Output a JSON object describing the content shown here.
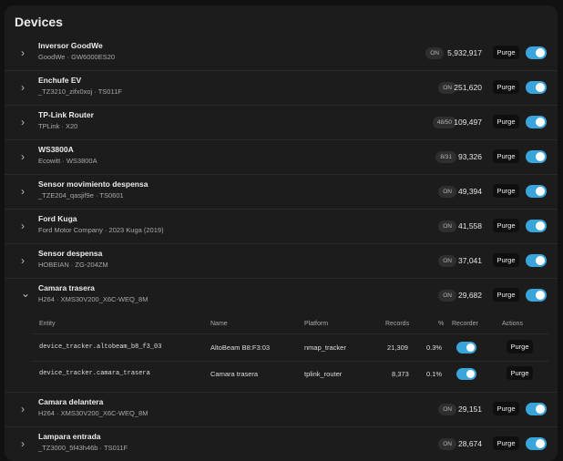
{
  "card": {
    "title": "Devices",
    "accent": "#3aa5db"
  },
  "devices": [
    {
      "name": "Inversor GoodWe",
      "sub": "GoodWe · GW6000ES20",
      "chip": "ON",
      "count": "5,932,917",
      "purge": "Purge",
      "enabled": true
    },
    {
      "name": "Enchufe EV",
      "sub": "_TZ3210_zifx0xoj · TS011F",
      "chip": "ON",
      "count": "251,620",
      "purge": "Purge",
      "enabled": true
    },
    {
      "name": "TP-Link Router",
      "sub": "TPLink · X20",
      "chip": "48/50",
      "count": "109,497",
      "purge": "Purge",
      "enabled": true
    },
    {
      "name": "WS3800A",
      "sub": "Ecowitt · WS3800A",
      "chip": "8/31",
      "count": "93,326",
      "purge": "Purge",
      "enabled": true
    },
    {
      "name": "Sensor movimiento despensa",
      "sub": "_TZE204_qasjif9e · TS0601",
      "chip": "ON",
      "count": "49,394",
      "purge": "Purge",
      "enabled": true
    },
    {
      "name": "Ford Kuga",
      "sub": "Ford Motor Company · 2023 Kuga (2019)",
      "chip": "ON",
      "count": "41,558",
      "purge": "Purge",
      "enabled": true
    },
    {
      "name": "Sensor despensa",
      "sub": "HOBEIAN · ZG-204ZM",
      "chip": "ON",
      "count": "37,041",
      "purge": "Purge",
      "enabled": true
    },
    {
      "name": "Camara trasera",
      "sub": "H264 · XMS30V200_X6C-WEQ_8M",
      "chip": "ON",
      "count": "29,682",
      "purge": "Purge",
      "enabled": true
    },
    {
      "name": "Camara delantera",
      "sub": "H264 · XMS30V200_X6C-WEQ_8M",
      "chip": "ON",
      "count": "29,151",
      "purge": "Purge",
      "enabled": true
    },
    {
      "name": "Lampara entrada",
      "sub": "_TZ3000_5f43h46b · TS011F",
      "chip": "ON",
      "count": "28,674",
      "purge": "Purge",
      "enabled": true
    }
  ],
  "entity_table": {
    "headers": {
      "entity": "Entity",
      "name": "Name",
      "platform": "Platform",
      "records": "Records",
      "pct": "%",
      "recorder": "Recorder",
      "actions": "Actions"
    },
    "rows": [
      {
        "entity": "device_tracker.altobeam_b8_f3_03",
        "name": "AltoBeam B8:F3:03",
        "platform": "nmap_tracker",
        "records": "21,309",
        "pct": "0.3%",
        "recorder": true,
        "action": "Purge"
      },
      {
        "entity": "device_tracker.camara_trasera",
        "name": "Camara trasera",
        "platform": "tplink_router",
        "records": "8,373",
        "pct": "0.1%",
        "recorder": true,
        "action": "Purge"
      }
    ]
  },
  "icons": {
    "collapsed": "chevron-right-icon",
    "expanded": "chevron-down-icon"
  }
}
